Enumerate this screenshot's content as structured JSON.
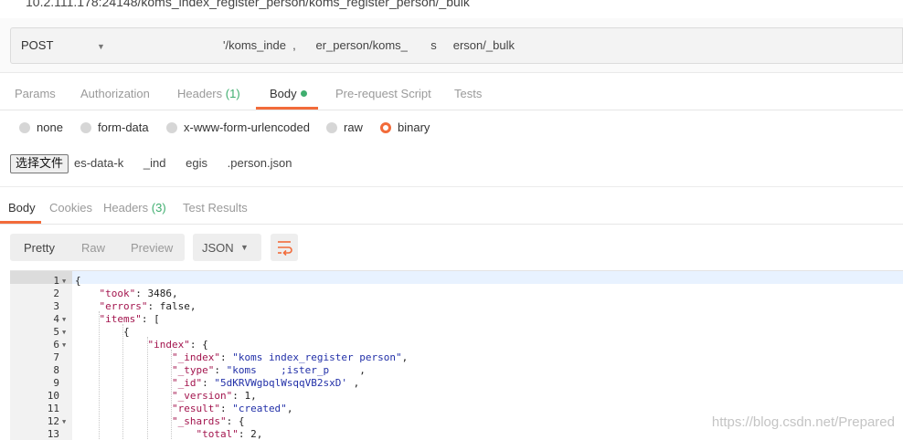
{
  "request": {
    "title": "10.2.111.178:24148/koms_index_register_person/koms_register_person/_bulk",
    "method": "POST",
    "url": "'/koms_inde  ,      er_person/koms_       s     erson/_bulk"
  },
  "request_tabs": [
    {
      "label": "Params",
      "count": ""
    },
    {
      "label": "Authorization",
      "count": ""
    },
    {
      "label": "Headers",
      "count": "(1)"
    },
    {
      "label": "Body",
      "count": ""
    },
    {
      "label": "Pre-request Script",
      "count": ""
    },
    {
      "label": "Tests",
      "count": ""
    }
  ],
  "body_types": [
    "none",
    "form-data",
    "x-www-form-urlencoded",
    "raw",
    "binary"
  ],
  "body_selected": "binary",
  "file": {
    "button_label": "选择文件",
    "name": "es-data-k      _ind      egis      .person.json"
  },
  "response_tabs": [
    {
      "label": "Body",
      "count": ""
    },
    {
      "label": "Cookies",
      "count": ""
    },
    {
      "label": "Headers",
      "count": "(3)"
    },
    {
      "label": "Test Results",
      "count": ""
    }
  ],
  "view_modes": [
    "Pretty",
    "Raw",
    "Preview"
  ],
  "active_view": "Pretty",
  "format": "JSON",
  "code_lines": [
    {
      "n": "1",
      "fold": true,
      "tokens": [
        [
          "p",
          "{"
        ]
      ]
    },
    {
      "n": "2",
      "fold": false,
      "tokens": [
        [
          "p",
          "    "
        ],
        [
          "k",
          "\"took\""
        ],
        [
          "p",
          ": "
        ],
        [
          "n",
          "3486"
        ],
        [
          "p",
          ","
        ]
      ]
    },
    {
      "n": "3",
      "fold": false,
      "tokens": [
        [
          "p",
          "    "
        ],
        [
          "k",
          "\"errors\""
        ],
        [
          "p",
          ": "
        ],
        [
          "n",
          "false"
        ],
        [
          "p",
          ","
        ]
      ]
    },
    {
      "n": "4",
      "fold": true,
      "tokens": [
        [
          "p",
          "    "
        ],
        [
          "k",
          "\"items\""
        ],
        [
          "p",
          ": ["
        ]
      ]
    },
    {
      "n": "5",
      "fold": true,
      "tokens": [
        [
          "p",
          "        {"
        ]
      ]
    },
    {
      "n": "6",
      "fold": true,
      "tokens": [
        [
          "p",
          "            "
        ],
        [
          "k",
          "\"index\""
        ],
        [
          "p",
          ": {"
        ]
      ]
    },
    {
      "n": "7",
      "fold": false,
      "tokens": [
        [
          "p",
          "                "
        ],
        [
          "k",
          "\"_index\""
        ],
        [
          "p",
          ": "
        ],
        [
          "s",
          "\"koms index_register person\""
        ],
        [
          "p",
          ","
        ]
      ]
    },
    {
      "n": "8",
      "fold": false,
      "tokens": [
        [
          "p",
          "                "
        ],
        [
          "k",
          "\"_type\""
        ],
        [
          "p",
          ": "
        ],
        [
          "s",
          "\"koms    ;ister_p"
        ],
        [
          "p",
          "     ,"
        ]
      ]
    },
    {
      "n": "9",
      "fold": false,
      "tokens": [
        [
          "p",
          "                "
        ],
        [
          "k",
          "\"_id\""
        ],
        [
          "p",
          ": "
        ],
        [
          "s",
          "\"5dKRVWgbqlWsqqVB2sxD'"
        ],
        [
          "p",
          " ,"
        ]
      ]
    },
    {
      "n": "10",
      "fold": false,
      "tokens": [
        [
          "p",
          "                "
        ],
        [
          "k",
          "\"_version\""
        ],
        [
          "p",
          ": "
        ],
        [
          "n",
          "1"
        ],
        [
          "p",
          ","
        ]
      ]
    },
    {
      "n": "11",
      "fold": false,
      "tokens": [
        [
          "p",
          "                "
        ],
        [
          "k",
          "\"result\""
        ],
        [
          "p",
          ": "
        ],
        [
          "s",
          "\"created\""
        ],
        [
          "p",
          ","
        ]
      ]
    },
    {
      "n": "12",
      "fold": true,
      "tokens": [
        [
          "p",
          "                "
        ],
        [
          "k",
          "\"_shards\""
        ],
        [
          "p",
          ": {"
        ]
      ]
    },
    {
      "n": "13",
      "fold": false,
      "tokens": [
        [
          "p",
          "                    "
        ],
        [
          "k",
          "\"total\""
        ],
        [
          "p",
          ": "
        ],
        [
          "n",
          "2"
        ],
        [
          "p",
          ","
        ]
      ]
    }
  ],
  "watermark": "https://blog.csdn.net/Prepared",
  "colors": {
    "accent": "#f26b3a",
    "count_green": "#3fae6f",
    "json_key": "#a3154e",
    "json_string": "#2230a8"
  }
}
